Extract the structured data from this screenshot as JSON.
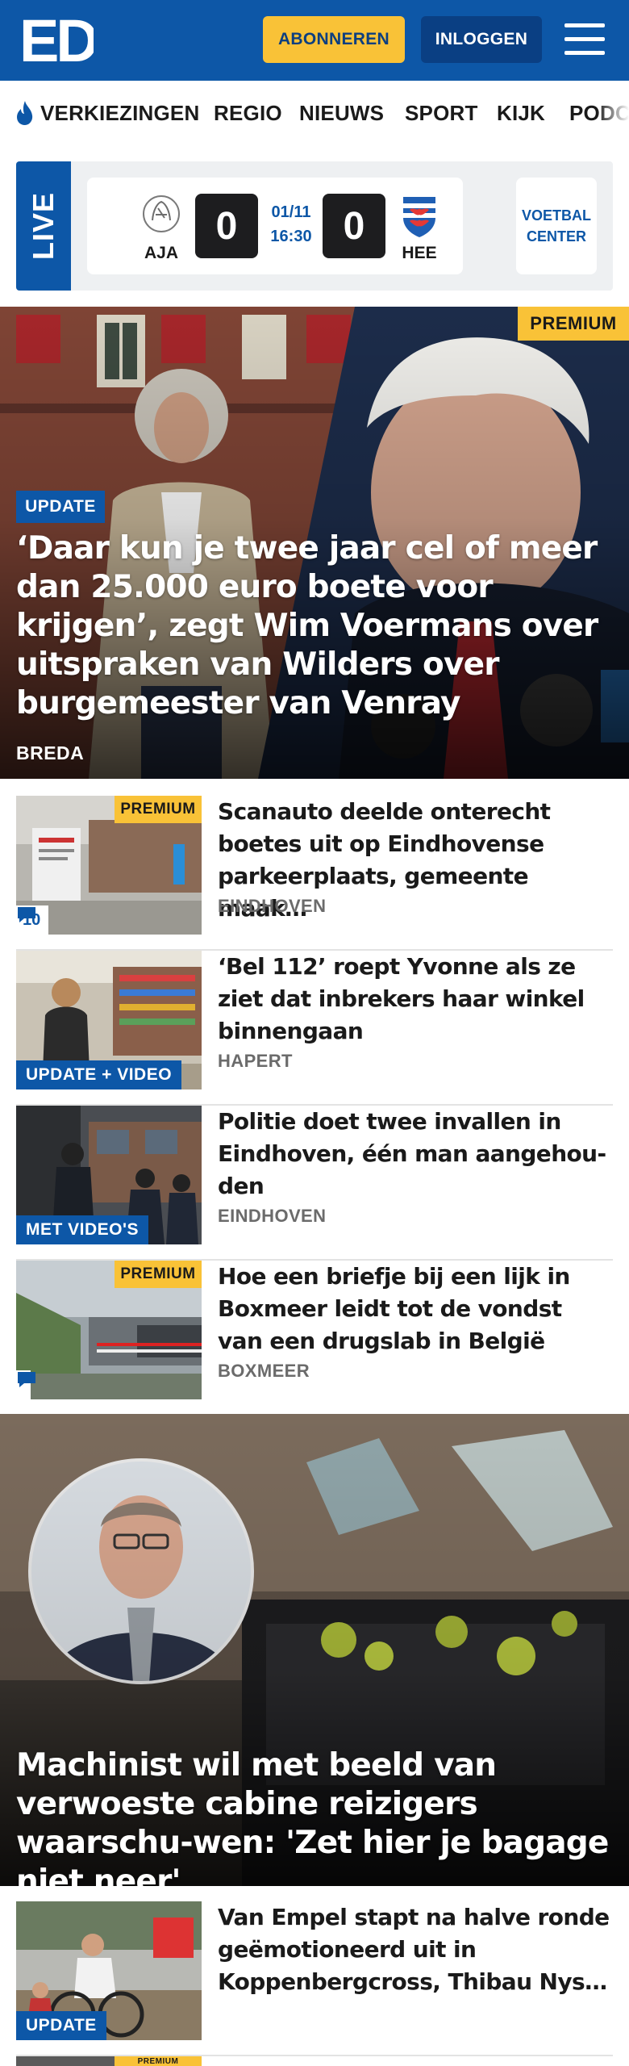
{
  "header": {
    "logo_text": "ED",
    "subscribe_label": "ABONNEREN",
    "login_label": "INLOGGEN"
  },
  "nav": {
    "items": [
      "VERKIEZINGEN",
      "REGIO",
      "NIEUWS",
      "SPORT",
      "KIJK",
      "PODCASTS"
    ]
  },
  "live": {
    "label": "LIVE",
    "home_team": "AJA",
    "away_team": "HEE",
    "home_score": "0",
    "away_score": "0",
    "date": "01/11",
    "time": "16:30",
    "voetbal_center_line1": "VOETBAL",
    "voetbal_center_line2": "CENTER"
  },
  "hero": {
    "premium": "PREMIUM",
    "label": "UPDATE",
    "title": "‘Daar kun je twee jaar cel of meer dan 25.000 euro boete voor krijgen’, zegt Wim Voermans over uitspraken van Wilders over burgemeester van Venray",
    "location": "BREDA"
  },
  "articles": [
    {
      "premium": "PREMIUM",
      "comments": "10",
      "title": "Scanauto deelde onterecht boetes uit op Eindhovense parkeerplaats, gemeente maak…",
      "location": "EINDHOVEN"
    },
    {
      "label": "UPDATE + VIDEO",
      "title": "‘Bel 112’ roept Yvonne als ze ziet dat inbrekers haar winkel binnengaan",
      "location": "HAPERT"
    },
    {
      "label": "MET VIDEO'S",
      "title": "Politie doet twee invallen in Eindhoven, één man aangehou-den",
      "location": "EINDHOVEN"
    },
    {
      "premium": "PREMIUM",
      "title": "Hoe een briefje bij een lijk in Boxmeer leidt tot de vondst van een drugslab in België",
      "location": "BOXMEER"
    }
  ],
  "hero2": {
    "title": "Machinist wil met beeld van verwoeste cabine reizigers waarschu-wen: 'Zet hier je bagage niet neer'"
  },
  "article_bottom": {
    "label": "UPDATE",
    "title": "Van Empel stapt na halve ronde geëmotioneerd uit in Koppenbergcross, Thibau Nys…",
    "premium": "PREMIUM"
  },
  "colors": {
    "brand_blue": "#0d57a7",
    "premium_yellow": "#f9c237",
    "dark_blue_button": "#0a3f83"
  }
}
